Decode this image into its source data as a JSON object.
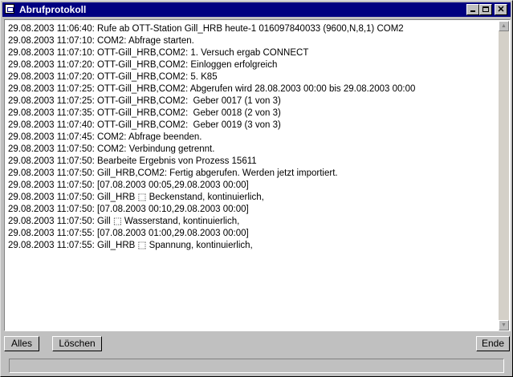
{
  "window": {
    "title": "Abrufprotokoll",
    "controls": {
      "minimize": "_",
      "maximize": "□",
      "close": "✕"
    }
  },
  "log": {
    "lines": [
      "29.08.2003 11:06:40: Rufe ab OTT-Station Gill_HRB heute-1 016097840033 (9600,N,8,1) COM2",
      "29.08.2003 11:07:10: COM2: Abfrage starten.",
      "29.08.2003 11:07:10: OTT-Gill_HRB,COM2: 1. Versuch ergab CONNECT",
      "29.08.2003 11:07:20: OTT-Gill_HRB,COM2: Einloggen erfolgreich",
      "29.08.2003 11:07:20: OTT-Gill_HRB,COM2: 5. K85",
      "29.08.2003 11:07:25: OTT-Gill_HRB,COM2: Abgerufen wird 28.08.2003 00:00 bis 29.08.2003 00:00",
      "29.08.2003 11:07:25: OTT-Gill_HRB,COM2:  Geber 0017 (1 von 3)",
      "29.08.2003 11:07:35: OTT-Gill_HRB,COM2:  Geber 0018 (2 von 3)",
      "29.08.2003 11:07:40: OTT-Gill_HRB,COM2:  Geber 0019 (3 von 3)",
      "29.08.2003 11:07:45: COM2: Abfrage beenden.",
      "29.08.2003 11:07:50: COM2: Verbindung getrennt.",
      "29.08.2003 11:07:50: Bearbeite Ergebnis von Prozess 15611",
      "29.08.2003 11:07:50: Gill_HRB,COM2: Fertig abgerufen. Werden jetzt importiert.",
      "29.08.2003 11:07:50: [07.08.2003 00:05,29.08.2003 00:00]",
      "29.08.2003 11:07:50: Gill_HRB ⬚ Beckenstand, kontinuierlich,",
      "29.08.2003 11:07:50: [07.08.2003 00:10,29.08.2003 00:00]",
      "29.08.2003 11:07:50: Gill ⬚ Wasserstand, kontinuierlich,",
      "29.08.2003 11:07:55: [07.08.2003 01:00,29.08.2003 00:00]",
      "29.08.2003 11:07:55: Gill_HRB ⬚ Spannung, kontinuierlich,"
    ]
  },
  "buttons": {
    "alles": "Alles",
    "loeschen": "Löschen",
    "ende": "Ende"
  },
  "scrollbar": {
    "up": "▲",
    "down": "▼"
  },
  "status": {
    "text": ""
  }
}
